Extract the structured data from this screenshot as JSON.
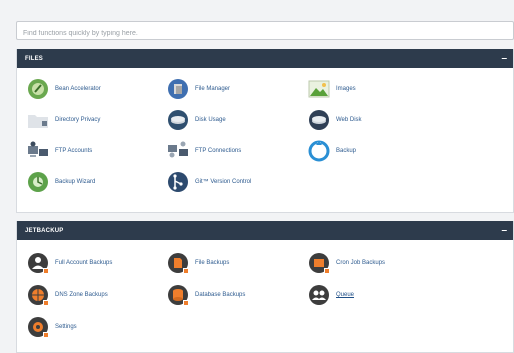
{
  "search": {
    "placeholder": "Find functions quickly by typing here."
  },
  "files": {
    "title": "FILES",
    "collapse": "–",
    "items": [
      {
        "label": "Bean Accelerator"
      },
      {
        "label": "File Manager"
      },
      {
        "label": "Images"
      },
      {
        "label": "Directory Privacy"
      },
      {
        "label": "Disk Usage"
      },
      {
        "label": "Web Disk"
      },
      {
        "label": "FTP Accounts"
      },
      {
        "label": "FTP Connections"
      },
      {
        "label": "Backup"
      },
      {
        "label": "Backup Wizard"
      },
      {
        "label": "Git™ Version Control"
      }
    ]
  },
  "jetbackup": {
    "title": "JETBACKUP",
    "collapse": "–",
    "items": [
      {
        "label": "Full Account Backups"
      },
      {
        "label": "File Backups"
      },
      {
        "label": "Cron Job Backups"
      },
      {
        "label": "DNS Zone Backups"
      },
      {
        "label": "Database Backups"
      },
      {
        "label": "Queue"
      },
      {
        "label": "Settings"
      }
    ]
  },
  "colors": {
    "header": "#2d3b4c",
    "link": "#2e5b8f",
    "jet_orange": "#ef7e2c",
    "jet_dark": "#3d3d3d"
  }
}
